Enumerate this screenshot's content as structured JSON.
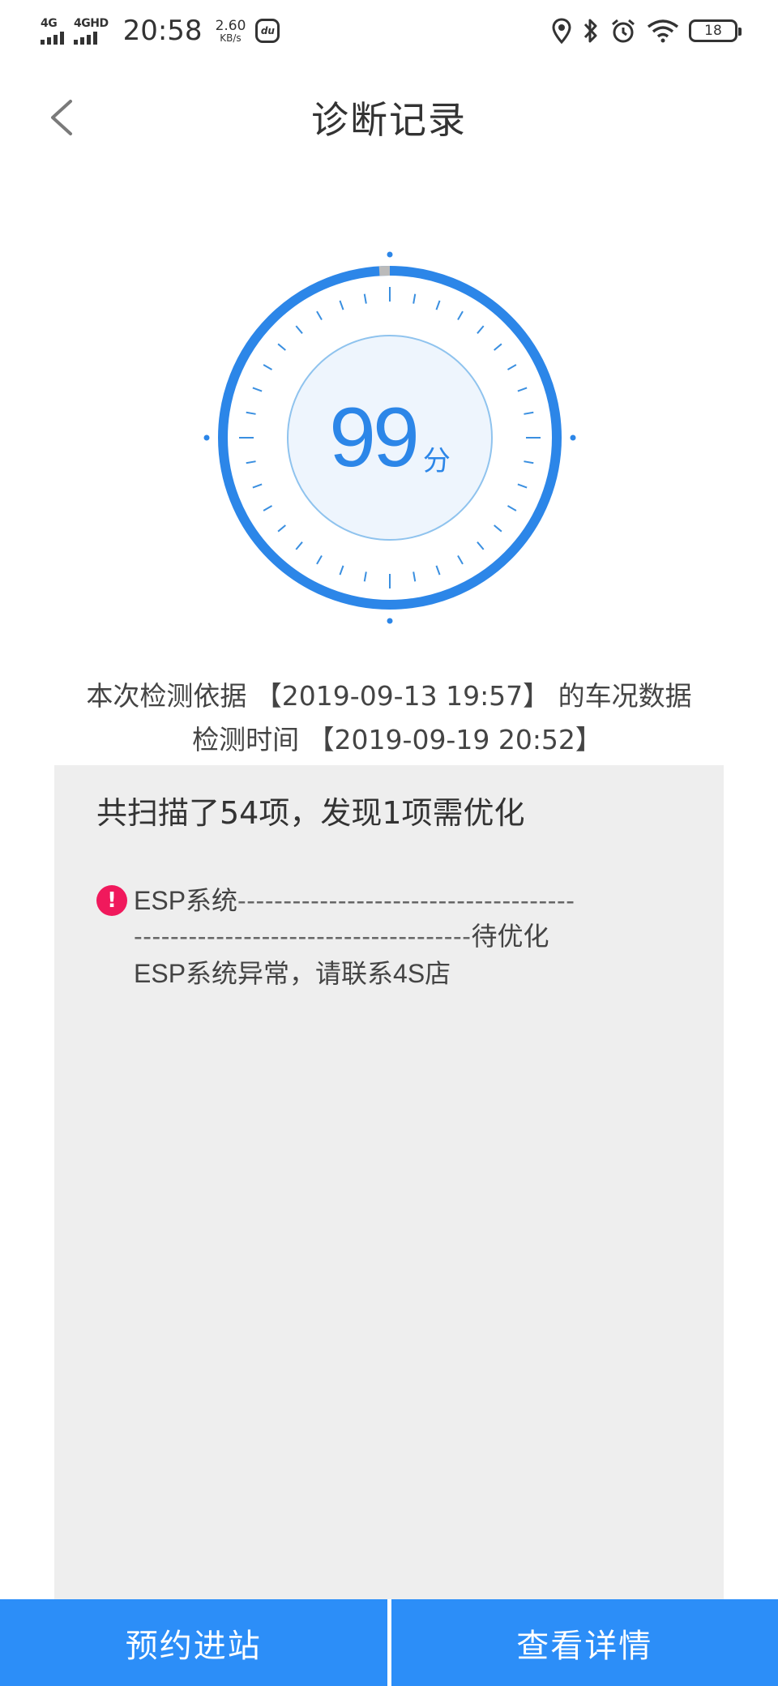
{
  "status_bar": {
    "net1": "4G",
    "net2": "4GHD",
    "time": "20:58",
    "speed_value": "2.60",
    "speed_unit": "KB/s",
    "app_icon": "du",
    "battery": "18",
    "icons": [
      "signal-icon",
      "du-app-icon",
      "location-icon",
      "bluetooth-icon",
      "alarm-icon",
      "wifi-icon",
      "battery-icon"
    ]
  },
  "header": {
    "title": "诊断记录",
    "back_icon": "chevron-left-icon"
  },
  "gauge": {
    "score": "99",
    "unit": "分",
    "score_fraction": 0.99,
    "colors": {
      "ring": "#2c86e8",
      "gap": "#bbbbbb",
      "inner": "#eef5fd"
    }
  },
  "info": {
    "line1": "本次检测依据 【2019-09-13 19:57】 的车况数据",
    "line2": "检测时间 【2019-09-19 20:52】"
  },
  "result": {
    "summary": "共扫描了54项，发现1项需优化",
    "issues": [
      {
        "icon": "alert-icon",
        "name": "ESP系统",
        "dashes1": "-------------------------------------",
        "dashes2": "-------------------------------------",
        "status": "待优化",
        "detail": "ESP系统异常，请联系4S店"
      }
    ]
  },
  "buttons": {
    "book": "预约进站",
    "details": "查看详情"
  },
  "colors": {
    "accent": "#2c8ef8",
    "alert": "#f0195c",
    "panel": "#eeeeee"
  }
}
